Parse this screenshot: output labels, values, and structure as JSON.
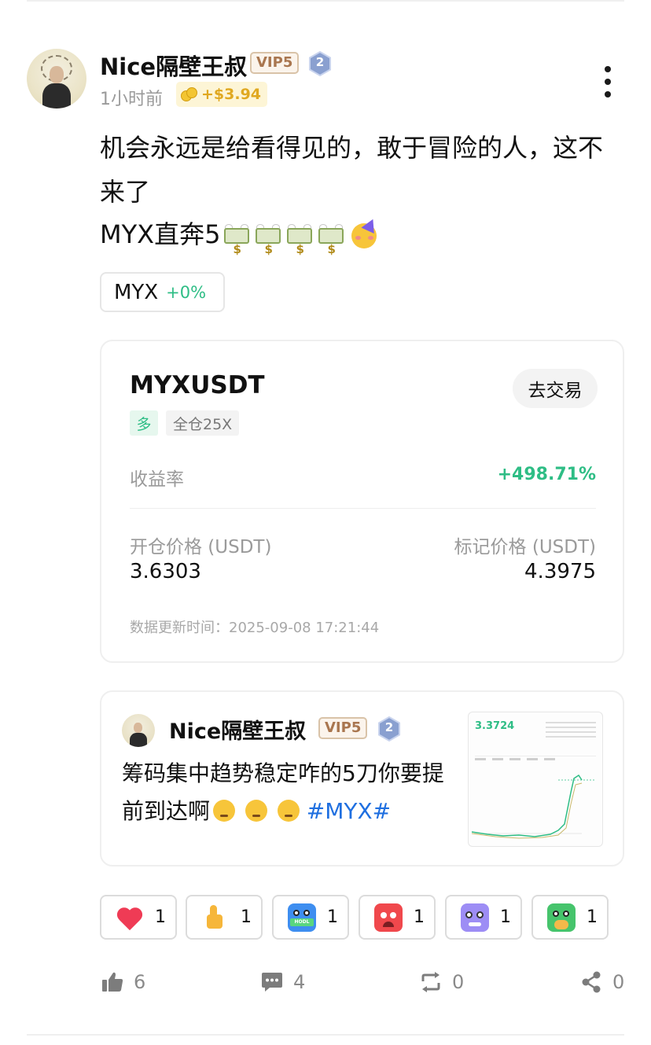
{
  "post": {
    "username": "Nice隔壁王叔",
    "vip": "VIP5",
    "level": "2",
    "time": "1小时前",
    "reward": "+$3.94",
    "text": "机会永远是给看得见的，敢于冒险的人，这不来了",
    "line3": "MYX直奔5",
    "icons": [
      "flying-money-icon",
      "flying-money-icon",
      "flying-money-icon",
      "flying-money-icon",
      "party-face-icon"
    ]
  },
  "ticker": {
    "symbol": "MYX",
    "change": "+0%",
    "change_color": "#2ebd85"
  },
  "position": {
    "pair": "MYXUSDT",
    "trade_button": "去交易",
    "side": "多",
    "margin": "全仓25X",
    "pnl_label": "收益率",
    "pnl_value": "+498.71%",
    "open_label": "开仓价格 (USDT)",
    "open_value": "3.6303",
    "mark_label": "标记价格 (USDT)",
    "mark_value": "4.3975",
    "updated_label": "数据更新时间：",
    "updated_value": "2025-09-08 17:21:44"
  },
  "quote": {
    "username": "Nice隔壁王叔",
    "vip": "VIP5",
    "level": "2",
    "text": "筹码集中趋势稳定咋的5刀你要提前到达啊",
    "hashtag": "#MYX#",
    "thumb_price": "3.3724"
  },
  "reactions": [
    {
      "icon": "heart-icon",
      "count": "1"
    },
    {
      "icon": "thumbs-up-icon",
      "count": "1"
    },
    {
      "icon": "hodl-icon",
      "count": "1"
    },
    {
      "icon": "angry-icon",
      "count": "1"
    },
    {
      "icon": "scared-icon",
      "count": "1"
    },
    {
      "icon": "sick-icon",
      "count": "1"
    }
  ],
  "actions": {
    "like": "6",
    "comment": "4",
    "repost": "0",
    "share": "0"
  },
  "colors": {
    "accent_green": "#2ebd85",
    "hashtag_blue": "#1f6fe0",
    "gold": "#e0a820"
  }
}
